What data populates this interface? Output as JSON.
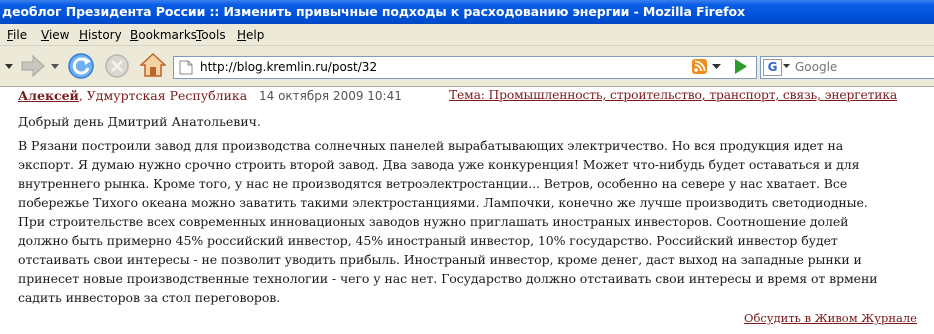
{
  "window": {
    "title": "деоблог Президента России :: Изменить привычные подходы к расходованию энергии - Mozilla Firefox"
  },
  "menu": {
    "items": [
      "File",
      "View",
      "History",
      "Bookmarks",
      "Tools",
      "Help"
    ]
  },
  "toolbar": {
    "back_icon": "back-arrow-icon",
    "forward_icon": "forward-arrow-icon",
    "reload_icon": "reload-icon",
    "stop_icon": "stop-icon",
    "home_icon": "home-icon",
    "address_url": "http://blog.kremlin.ru/post/32",
    "search_placeholder": "Google",
    "colors": {
      "reload": "#2f7fd6",
      "home": "#c0632a",
      "go": "#2e9b2e",
      "rss": "#f08c1c"
    }
  },
  "post": {
    "author": "Алексей",
    "region": ", Удмуртская Республика",
    "date": "14 октября 2009 10:41",
    "topic": "Тема: Промышленность, строительство, транспорт, связь, энергетика",
    "greeting": "Добрый день Дмитрий Анатольевич.",
    "lines": [
      "В Рязани построили завод для производства солнечных панелей вырабатывающих электричество. Но вся продукция идет на",
      "экспорт. Я думаю нужно срочно строить второй завод. Два завода уже конкуренция! Может что-нибудь будет оставаться и для",
      "внутреннего рынка. Кроме того, у нас не производятся ветроэлектростанции... Ветров, особенно на севере у нас хватает. Все",
      "побережье Тихого океана можно заватить такими электростанциями. Лампочки, конечно же лучше производить светодиодные.",
      "При строительстве всех современных инновационых заводов нужно приглашать иностраных инвесторов. Соотношение долей",
      "должно быть примерно 45% российский инвестор, 45% иностраный инвестор, 10% государство. Российский инвестор будет",
      "отстаивать свои интересы - не позволит уводить прибыль. Иностраный инвестор, кроме денег, даст выход на западные рынки и",
      "принесет новые производственные технологии - чего у нас нет. Государство должно отстаивать свои интересы и время от врмени",
      "садить инвесторов за стол переговоров."
    ],
    "discuss_link": "Обсудить в Живом Журнале",
    "colors": {
      "link": "#7a1a1a",
      "text": "#1a1a1a"
    }
  }
}
